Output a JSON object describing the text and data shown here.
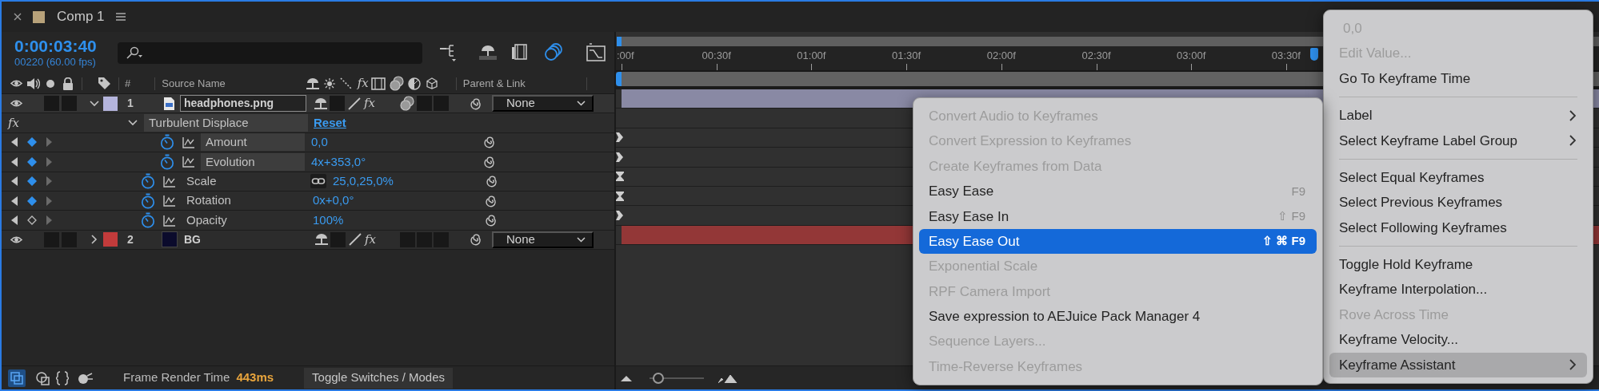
{
  "panel": {
    "title": "Comp 1"
  },
  "timecode": "0:00:03:40",
  "frame_info": "00220 (60.00 fps)",
  "toolbar": [
    {
      "on": false
    },
    {
      "on": false
    },
    {
      "on": false
    },
    {
      "on": true
    },
    {
      "on": false
    }
  ],
  "header": {
    "number": "#",
    "source_name": "Source Name",
    "fx": "fx",
    "parent": "Parent & Link"
  },
  "layers": [
    {
      "number": "1",
      "name": "headphones.png",
      "kind": "footage",
      "color": "#b4b4dc",
      "expanded": true,
      "selected": true,
      "fx": "fx",
      "parent": "None",
      "effects": [
        {
          "fx": "fx",
          "name": "Turbulent Displace",
          "reset": "Reset",
          "expanded": true,
          "properties": [
            {
              "name": "Amount",
              "value": "0,0",
              "keyframe": true,
              "kind": "arrow"
            },
            {
              "name": "Evolution",
              "value": "4x+353,0°",
              "keyframe": true,
              "kind": "arrow"
            }
          ]
        }
      ],
      "transform": [
        {
          "name": "Scale",
          "value": "25,0,25,0%",
          "linked": true,
          "keyframe": true,
          "kind": "hourglass"
        },
        {
          "name": "Rotation",
          "value": "0x+0,0°",
          "linked": false,
          "keyframe": true,
          "kind": "hourglass"
        },
        {
          "name": "Opacity",
          "value": "100%",
          "linked": false,
          "keyframe": false,
          "kind": "arrow"
        }
      ]
    },
    {
      "number": "2",
      "name": "BG",
      "kind": "solid",
      "color": "#c23b3b",
      "expanded": false,
      "selected": false,
      "fx": "fx",
      "parent": "None"
    }
  ],
  "timeline": {
    "ticks": [
      ":00f",
      "00:30f",
      "01:00f",
      "01:30f",
      "02:00f",
      "02:30f",
      "03:00f",
      "03:30f"
    ],
    "playhead": {
      "level": 0.71
    },
    "zoom": {
      "level": 0.08
    }
  },
  "status": {
    "render_label": "Frame Render Time",
    "render_time": "443ms",
    "toggle": "Toggle Switches / Modes"
  },
  "context_menu": {
    "items": [
      {
        "kind": "value",
        "label": "0,0",
        "disabled": true,
        "selected": false
      },
      {
        "kind": "item",
        "label": "Edit Value...",
        "disabled": true,
        "selected": false
      },
      {
        "kind": "item",
        "label": "Go To Keyframe Time",
        "disabled": false,
        "selected": false
      },
      {
        "kind": "separator"
      },
      {
        "kind": "item",
        "label": "Label",
        "disabled": false,
        "selected": false,
        "submenu": true
      },
      {
        "kind": "item",
        "label": "Select Keyframe Label Group",
        "disabled": false,
        "selected": false,
        "submenu": true
      },
      {
        "kind": "separator"
      },
      {
        "kind": "item",
        "label": "Select Equal Keyframes",
        "disabled": false,
        "selected": false
      },
      {
        "kind": "item",
        "label": "Select Previous Keyframes",
        "disabled": false,
        "selected": false
      },
      {
        "kind": "item",
        "label": "Select Following Keyframes",
        "disabled": false,
        "selected": false
      },
      {
        "kind": "separator"
      },
      {
        "kind": "item",
        "label": "Toggle Hold Keyframe",
        "disabled": false,
        "selected": false
      },
      {
        "kind": "item",
        "label": "Keyframe Interpolation...",
        "disabled": false,
        "selected": false
      },
      {
        "kind": "item",
        "label": "Rove Across Time",
        "disabled": true,
        "selected": false
      },
      {
        "kind": "item",
        "label": "Keyframe Velocity...",
        "disabled": false,
        "selected": false
      },
      {
        "kind": "item",
        "label": "Keyframe Assistant",
        "disabled": false,
        "selected": true,
        "submenu": true
      }
    ]
  },
  "submenu": {
    "items": [
      {
        "label": "Convert Audio to Keyframes",
        "disabled": true,
        "selected": false
      },
      {
        "label": "Convert Expression to Keyframes",
        "disabled": true,
        "selected": false
      },
      {
        "label": "Create Keyframes from Data",
        "disabled": true,
        "selected": false
      },
      {
        "label": "Easy Ease",
        "shortcut": "F9",
        "disabled": false,
        "selected": false
      },
      {
        "label": "Easy Ease In",
        "shortcut": "⇧ F9",
        "disabled": false,
        "selected": false
      },
      {
        "label": "Easy Ease Out",
        "shortcut": "⇧ ⌘ F9",
        "disabled": false,
        "selected": true
      },
      {
        "label": "Exponential Scale",
        "disabled": true,
        "selected": false
      },
      {
        "label": "RPF Camera Import",
        "disabled": true,
        "selected": false
      },
      {
        "label": "Save expression to AEJuice Pack Manager 4",
        "disabled": false,
        "selected": false
      },
      {
        "label": "Sequence Layers...",
        "disabled": true,
        "selected": false
      },
      {
        "label": "Time-Reverse Keyframes",
        "disabled": true,
        "selected": false
      }
    ]
  }
}
